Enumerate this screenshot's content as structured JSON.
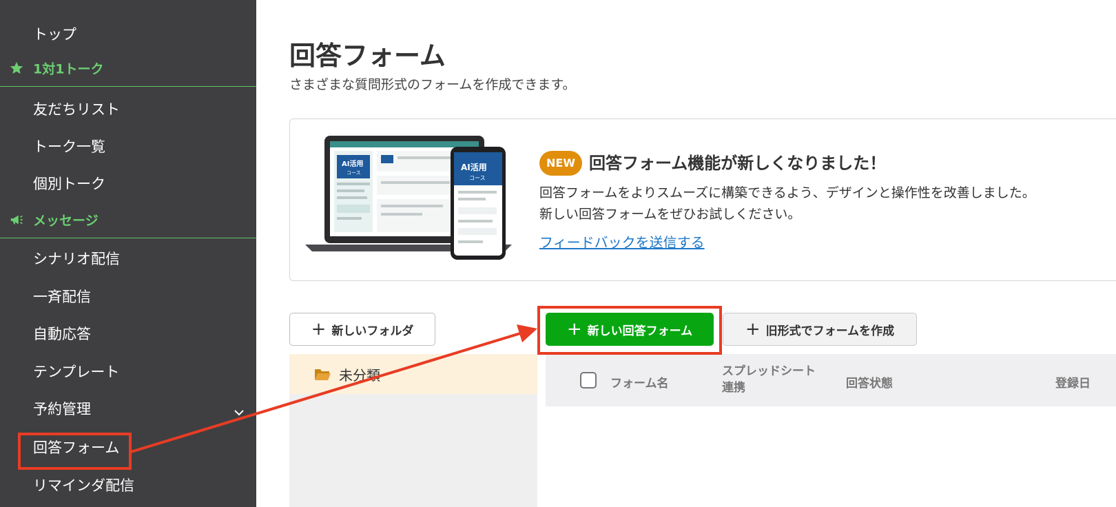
{
  "sidebar": {
    "items": [
      {
        "label": "トップ"
      },
      {
        "label": "1対1トーク",
        "section": true,
        "icon": "star-icon"
      },
      {
        "label": "友だちリスト"
      },
      {
        "label": "トーク一覧"
      },
      {
        "label": "個別トーク"
      },
      {
        "label": "メッセージ",
        "section": true,
        "icon": "megaphone-icon"
      },
      {
        "label": "シナリオ配信"
      },
      {
        "label": "一斉配信"
      },
      {
        "label": "自動応答"
      },
      {
        "label": "テンプレート"
      },
      {
        "label": "予約管理",
        "expandable": true,
        "icon": "chevron-down-icon"
      },
      {
        "label": "回答フォーム",
        "highlighted": true
      },
      {
        "label": "リマインダ配信"
      }
    ]
  },
  "page": {
    "title": "回答フォーム",
    "subtitle": "さまざまな質問形式のフォームを作成できます。"
  },
  "banner": {
    "badge": "NEW",
    "title": "回答フォーム機能が新しくなりました！",
    "desc_line1": "回答フォームをよりスムーズに構築できるよう、デザインと操作性を改善しました。",
    "desc_line2": "新しい回答フォームをぜひお試しください。",
    "link": "フィードバックを送信する",
    "illustration": {
      "laptop_badge": "AI活用",
      "laptop_sub": "コース",
      "phone_badge": "AI活用",
      "phone_sub": "コース"
    }
  },
  "actions": {
    "new_folder": "新しいフォルダ",
    "new_form": "新しい回答フォーム",
    "old_form": "旧形式でフォームを作成"
  },
  "folders": [
    {
      "label": "未分類",
      "selected": true
    }
  ],
  "table": {
    "columns": {
      "name": "フォーム名",
      "sheet_line1": "スプレッドシート",
      "sheet_line2": "連携",
      "status": "回答状態",
      "date": "登録日"
    }
  },
  "colors": {
    "sidebar_bg": "#3f3f41",
    "accent_green": "#08a712",
    "section_green": "#6ccf72",
    "badge_orange": "#e08e0b",
    "link_blue": "#1f78c8",
    "annotation_red": "#e83c24"
  }
}
